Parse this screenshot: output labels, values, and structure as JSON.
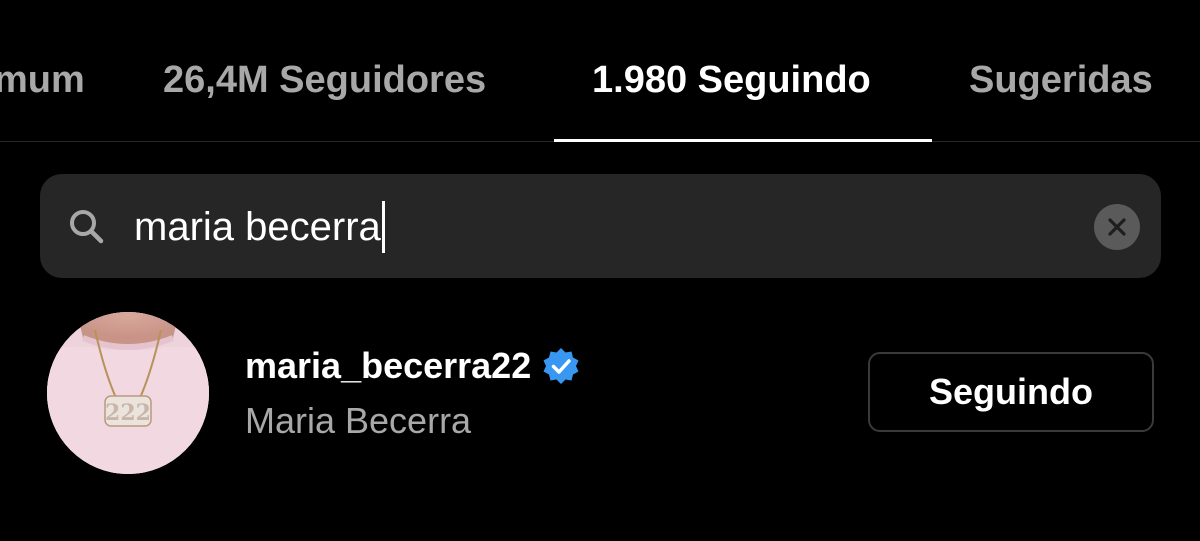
{
  "tabs": [
    {
      "label": "mum",
      "active": false
    },
    {
      "label": "26,4M Seguidores",
      "active": false
    },
    {
      "label": "1.980 Seguindo",
      "active": true
    },
    {
      "label": "Sugeridas",
      "active": false
    }
  ],
  "search": {
    "value": "maria becerra",
    "icon": "search-icon",
    "clear_icon": "close-icon"
  },
  "result": {
    "username": "maria_becerra22",
    "verified": true,
    "full_name": "Maria Becerra",
    "button_label": "Seguindo",
    "avatar_pendant_text": "222"
  },
  "colors": {
    "background": "#000000",
    "search_bg": "#262626",
    "secondary_text": "#a8a8a8",
    "verified_blue": "#3897f0",
    "button_border": "#3a3a3a"
  }
}
